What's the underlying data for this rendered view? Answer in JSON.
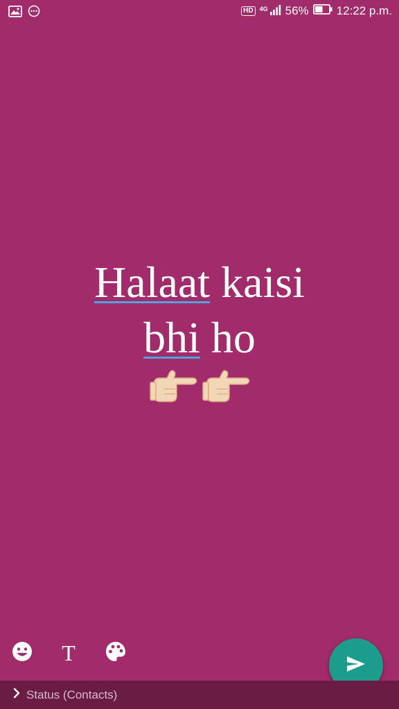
{
  "status_bar": {
    "left_icons": [
      "gallery-icon",
      "more-dots-icon"
    ],
    "hd_label": "HD",
    "network_label": "4G",
    "battery_percent": "56%",
    "battery_level": 0.56,
    "time": "12:22 p.m."
  },
  "story": {
    "line1_word1": "Halaat",
    "line1_word2": "kaisi",
    "line2_word1": "bhi",
    "line2_word2": "ho",
    "emoji_icons": [
      "pointing-left-icon",
      "pointing-left-icon"
    ]
  },
  "toolbar": {
    "text_tool_label": "T",
    "icons": [
      "emoji-icon",
      "text-icon",
      "palette-icon"
    ]
  },
  "send": {
    "icon": "send-icon"
  },
  "audience": {
    "label": "Status (Contacts)",
    "icon": "chevron-right-icon"
  },
  "colors": {
    "background": "#A22B6B",
    "bottom_bar": "#6B1C45",
    "send_button": "#1C9C8A",
    "spell_underline": "#4FA3E0"
  }
}
